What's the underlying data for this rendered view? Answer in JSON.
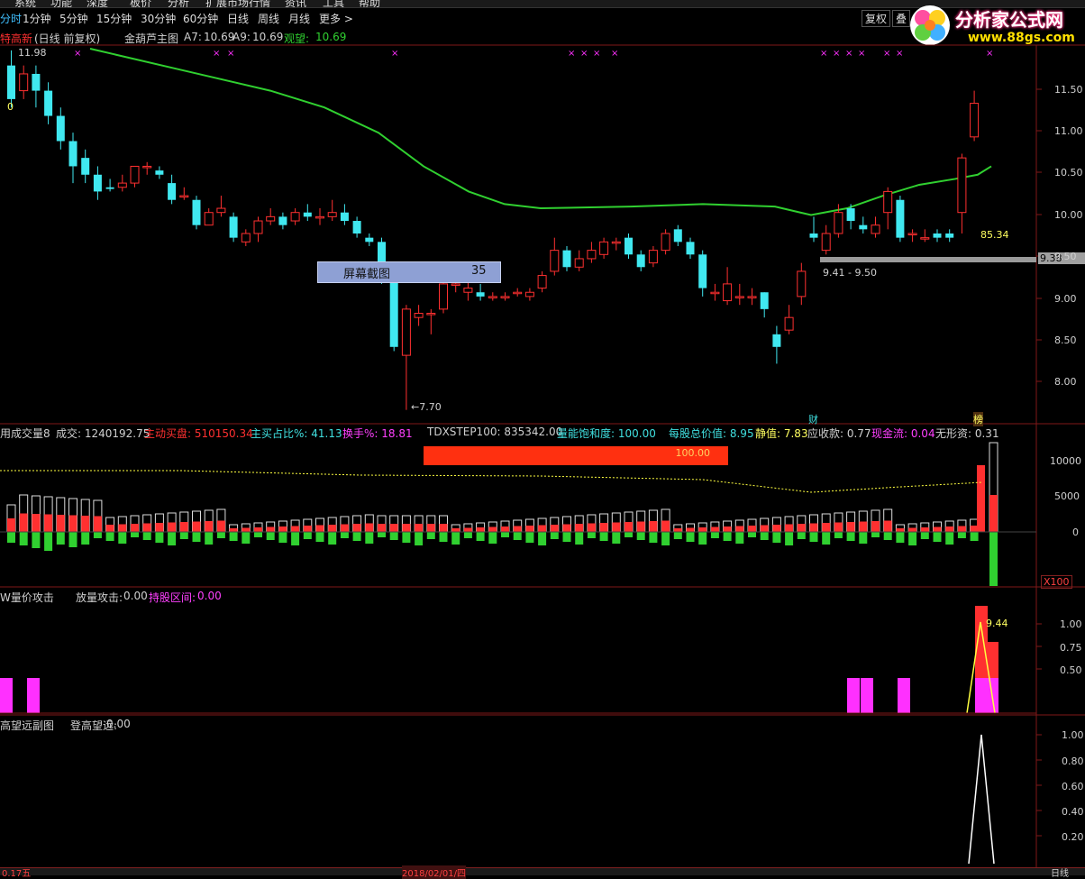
{
  "menu": {
    "items": [
      "系统",
      "功能",
      "深度",
      "板价",
      "分析",
      "扩展市场行情",
      "资讯",
      "工具",
      "帮助"
    ]
  },
  "toolbar": {
    "tabs": [
      "分时",
      "1分钟",
      "5分钟",
      "15分钟",
      "30分钟",
      "60分钟",
      "日线",
      "周线",
      "月线",
      "更多 >"
    ],
    "right_buttons": [
      "复权",
      "叠"
    ]
  },
  "logo": {
    "title": "分析家公式网",
    "url": "www.88gs.com"
  },
  "main_panel": {
    "stock_name": "特高新",
    "period": "(日线 前复权)",
    "indicator": "金葫芦主图",
    "a7_label": "A7:",
    "a7_value": "10.69",
    "a9_label": "A9:",
    "a9_value": "10.69",
    "guan_label": "观望:",
    "guan_value": "10.69",
    "high_mark": "11.98",
    "low_mark": "←7.70",
    "range_label": "9.41 - 9.50",
    "right_mark": "85.34",
    "price_tag": "9.38",
    "zero_mark": "0",
    "cai_badge": "财",
    "bang_badge": "榜",
    "price_axis": [
      "11.50",
      "11.00",
      "10.50",
      "10.00",
      "9.50",
      "9.00",
      "8.50",
      "8.00"
    ]
  },
  "screenshot_popup": {
    "label": "屏幕截图",
    "value": "35"
  },
  "volume_panel": {
    "title": "用成交量8",
    "fields": [
      {
        "label": "成交:",
        "value": "1240192.75",
        "color": "#d0d0d0"
      },
      {
        "label": "主动买盘:",
        "value": "510150.34",
        "color": "#ff3030"
      },
      {
        "label": "主买占比%:",
        "value": "41.13",
        "color": "#40e0e0"
      },
      {
        "label": "换手%:",
        "value": "18.81",
        "color": "#ff40ff"
      },
      {
        "label": "TDXSTEP100:",
        "value": "835342.00",
        "color": "#d0d0d0"
      },
      {
        "label": "量能饱和度:",
        "value": "100.00",
        "color": "#40e0e0"
      },
      {
        "label": "每股总价值:",
        "value": "8.95",
        "color": "#40e0e0"
      },
      {
        "label": "静值:",
        "value": "7.83",
        "color": "#ffff60"
      },
      {
        "label": "应收款:",
        "value": "0.77",
        "color": "#d0d0d0"
      },
      {
        "label": "现金流:",
        "value": "0.04",
        "color": "#ff40ff"
      },
      {
        "label": "无形资:",
        "value": "0.31",
        "color": "#d0d0d0"
      }
    ],
    "saturation_bar": "100.00",
    "axis": [
      "10000",
      "5000",
      "0"
    ],
    "multiplier": "X100"
  },
  "attack_panel": {
    "title": "W量价攻击",
    "f1_label": "放量攻击:",
    "f1_value": "0.00",
    "f2_label": "持股区间:",
    "f2_value": "0.00",
    "peak_label": "9.44",
    "axis": [
      "1.00",
      "0.75",
      "0.50"
    ]
  },
  "far_panel": {
    "title": "高望远副图",
    "f1_label": "登高望远:",
    "f1_value": "0.00",
    "axis": [
      "1.00",
      "0.80",
      "0.60",
      "0.40",
      "0.20"
    ]
  },
  "bottom": {
    "date": "2018/02/01/四",
    "left_label": "0.17五",
    "period_btn": "日线"
  },
  "colors": {
    "up": "#ff3030",
    "down": "#40e8f0",
    "ma": "#30d030",
    "grid": "#801818",
    "magenta": "#ff30ff"
  },
  "chart_data": {
    "type": "candlestick",
    "ylim": [
      7.6,
      12.0
    ],
    "candles": [
      [
        11.8,
        11.4,
        11.98,
        11.3
      ],
      [
        11.5,
        11.7,
        11.8,
        11.4
      ],
      [
        11.7,
        11.5,
        11.8,
        11.3
      ],
      [
        11.5,
        11.2,
        11.6,
        11.1
      ],
      [
        11.2,
        10.9,
        11.3,
        10.8
      ],
      [
        10.9,
        10.6,
        11.0,
        10.4
      ],
      [
        10.7,
        10.5,
        10.8,
        10.4
      ],
      [
        10.5,
        10.3,
        10.6,
        10.2
      ],
      [
        10.35,
        10.33,
        10.45,
        10.3
      ],
      [
        10.35,
        10.4,
        10.5,
        10.3
      ],
      [
        10.4,
        10.6,
        10.6,
        10.35
      ],
      [
        10.6,
        10.6,
        10.65,
        10.5
      ],
      [
        10.55,
        10.5,
        10.6,
        10.45
      ],
      [
        10.4,
        10.2,
        10.5,
        10.15
      ],
      [
        10.25,
        10.25,
        10.35,
        10.2
      ],
      [
        10.2,
        9.9,
        10.25,
        9.85
      ],
      [
        9.9,
        10.05,
        10.1,
        9.9
      ],
      [
        10.05,
        10.1,
        10.25,
        10.0
      ],
      [
        10.0,
        9.75,
        10.05,
        9.7
      ],
      [
        9.7,
        9.8,
        9.85,
        9.65
      ],
      [
        9.8,
        9.95,
        10.0,
        9.7
      ],
      [
        9.95,
        10.0,
        10.1,
        9.9
      ],
      [
        10.0,
        9.9,
        10.05,
        9.85
      ],
      [
        9.95,
        10.05,
        10.1,
        9.9
      ],
      [
        10.05,
        10.0,
        10.15,
        9.95
      ],
      [
        10.0,
        10.0,
        10.1,
        9.9
      ],
      [
        10.0,
        10.05,
        10.2,
        9.95
      ],
      [
        10.05,
        9.95,
        10.15,
        9.9
      ],
      [
        9.95,
        9.8,
        10.0,
        9.75
      ],
      [
        9.75,
        9.7,
        9.8,
        9.65
      ],
      [
        9.7,
        9.3,
        9.75,
        9.2
      ],
      [
        9.3,
        8.45,
        9.35,
        8.4
      ],
      [
        8.35,
        8.9,
        8.95,
        7.7
      ],
      [
        8.8,
        8.85,
        8.95,
        8.7
      ],
      [
        8.85,
        8.85,
        8.9,
        8.6
      ],
      [
        8.9,
        9.2,
        9.3,
        8.85
      ],
      [
        9.2,
        9.2,
        9.3,
        9.1
      ],
      [
        9.1,
        9.15,
        9.25,
        9.0
      ],
      [
        9.1,
        9.05,
        9.2,
        9.0
      ],
      [
        9.05,
        9.05,
        9.1,
        9.0
      ],
      [
        9.05,
        9.05,
        9.1,
        9.0
      ],
      [
        9.1,
        9.1,
        9.15,
        9.05
      ],
      [
        9.05,
        9.1,
        9.15,
        9.0
      ],
      [
        9.15,
        9.3,
        9.35,
        9.1
      ],
      [
        9.35,
        9.6,
        9.75,
        9.3
      ],
      [
        9.6,
        9.4,
        9.65,
        9.35
      ],
      [
        9.4,
        9.5,
        9.6,
        9.35
      ],
      [
        9.5,
        9.6,
        9.7,
        9.45
      ],
      [
        9.55,
        9.7,
        9.75,
        9.5
      ],
      [
        9.7,
        9.7,
        9.75,
        9.6
      ],
      [
        9.75,
        9.55,
        9.8,
        9.5
      ],
      [
        9.55,
        9.4,
        9.6,
        9.35
      ],
      [
        9.45,
        9.6,
        9.65,
        9.4
      ],
      [
        9.6,
        9.8,
        9.85,
        9.55
      ],
      [
        9.85,
        9.7,
        9.9,
        9.65
      ],
      [
        9.7,
        9.55,
        9.75,
        9.5
      ],
      [
        9.55,
        9.15,
        9.6,
        9.05
      ],
      [
        9.1,
        9.1,
        9.2,
        9.0
      ],
      [
        9.0,
        9.2,
        9.4,
        8.95
      ],
      [
        9.05,
        9.05,
        9.2,
        8.95
      ],
      [
        9.05,
        9.05,
        9.15,
        8.95
      ],
      [
        9.1,
        8.9,
        9.1,
        8.8
      ],
      [
        8.6,
        8.45,
        8.7,
        8.25
      ],
      [
        8.65,
        8.8,
        8.95,
        8.6
      ],
      [
        9.05,
        9.35,
        9.45,
        8.95
      ],
      [
        9.8,
        9.75,
        10.0,
        9.7
      ],
      [
        9.6,
        9.8,
        9.9,
        9.55
      ],
      [
        9.8,
        10.05,
        10.15,
        9.75
      ],
      [
        10.1,
        9.95,
        10.15,
        9.85
      ],
      [
        9.9,
        9.85,
        10.0,
        9.8
      ],
      [
        9.8,
        9.9,
        10.0,
        9.75
      ],
      [
        10.05,
        10.3,
        10.35,
        9.85
      ],
      [
        10.2,
        9.75,
        10.25,
        9.7
      ],
      [
        9.8,
        9.8,
        9.85,
        9.7
      ],
      [
        9.75,
        9.75,
        9.85,
        9.7
      ],
      [
        9.8,
        9.75,
        9.85,
        9.7
      ],
      [
        9.8,
        9.75,
        9.85,
        9.7
      ],
      [
        10.05,
        10.7,
        10.75,
        9.8
      ],
      [
        10.95,
        11.35,
        11.5,
        10.9
      ]
    ]
  }
}
